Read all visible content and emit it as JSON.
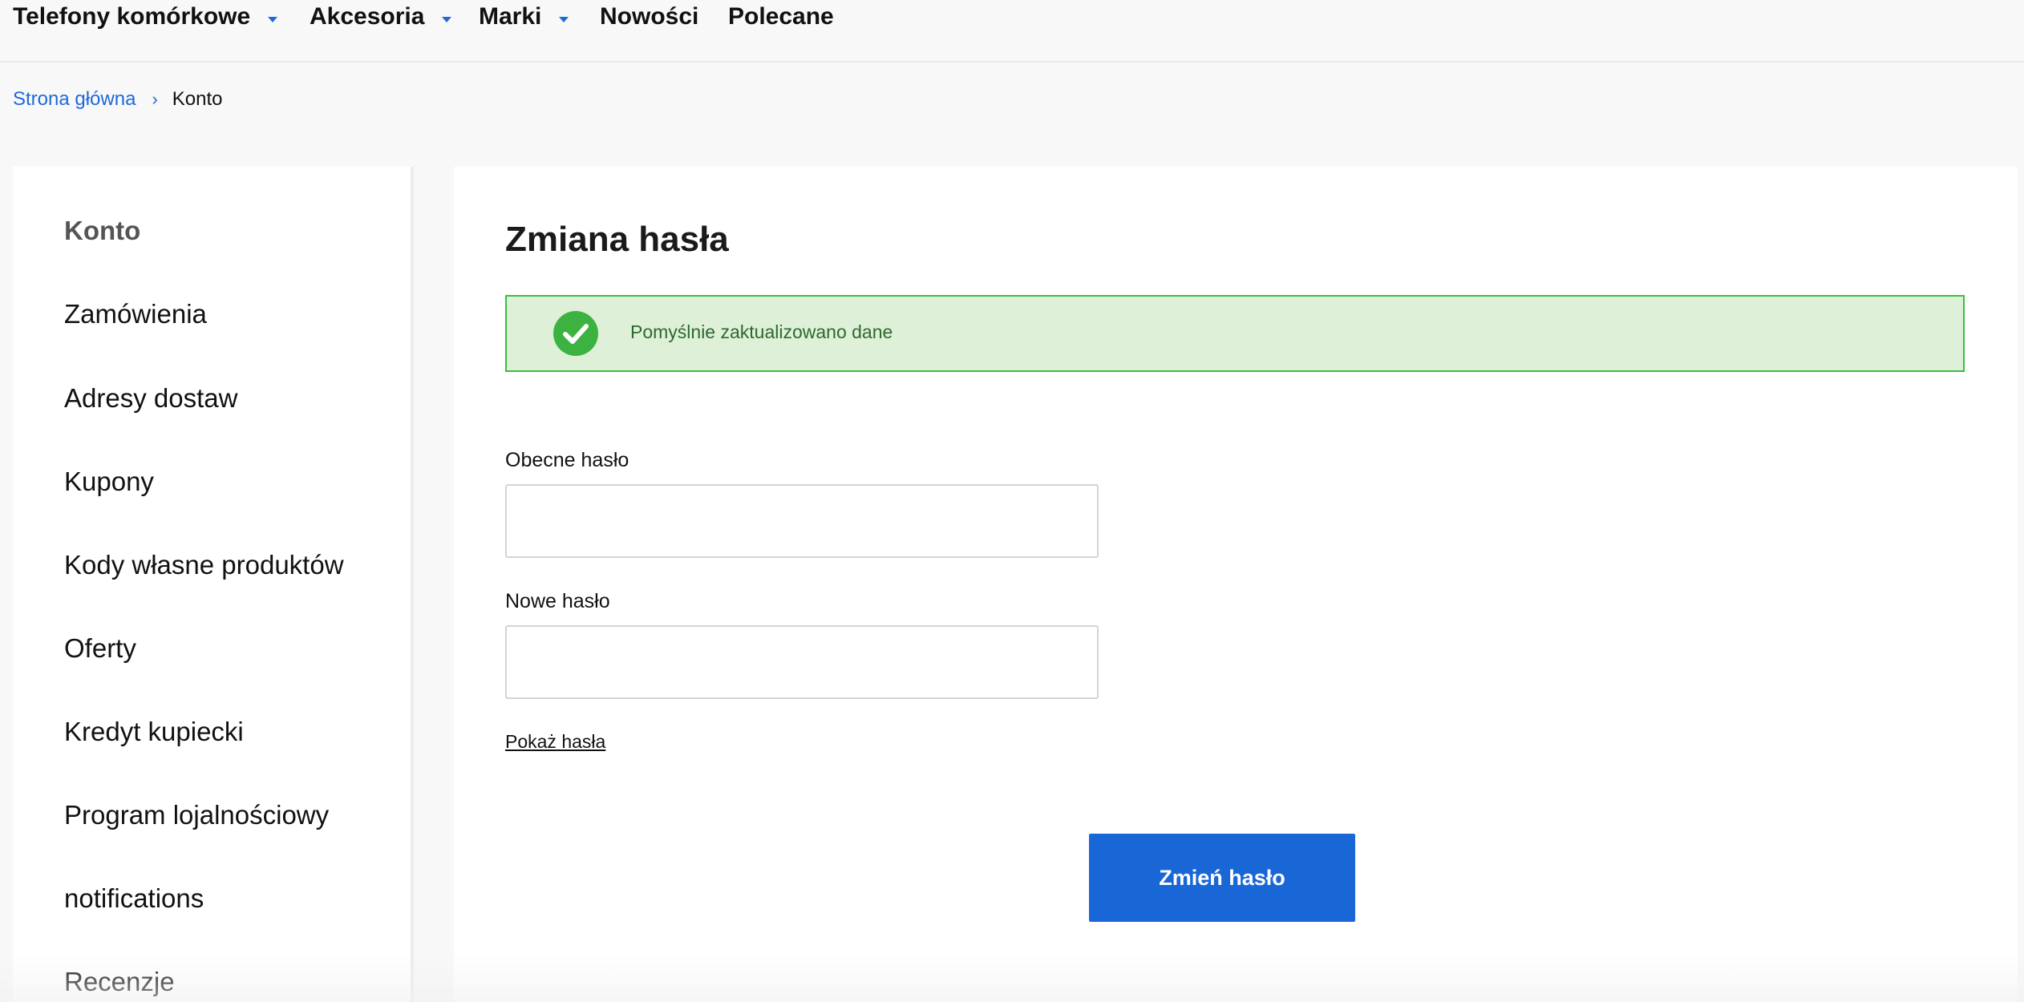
{
  "nav": {
    "items": [
      {
        "label": "Telefony komórkowe",
        "has_dropdown": true
      },
      {
        "label": "Akcesoria",
        "has_dropdown": true
      },
      {
        "label": "Marki",
        "has_dropdown": true
      },
      {
        "label": "Nowości",
        "has_dropdown": false
      },
      {
        "label": "Polecane",
        "has_dropdown": false
      }
    ]
  },
  "breadcrumb": {
    "home": "Strona główna",
    "separator": "›",
    "current": "Konto"
  },
  "sidebar": {
    "items": [
      {
        "label": "Konto",
        "active": true
      },
      {
        "label": "Zamówienia",
        "active": false
      },
      {
        "label": "Adresy dostaw",
        "active": false
      },
      {
        "label": "Kupony",
        "active": false
      },
      {
        "label": "Kody własne produktów",
        "active": false
      },
      {
        "label": "Oferty",
        "active": false
      },
      {
        "label": "Kredyt kupiecki",
        "active": false
      },
      {
        "label": "Program lojalnościowy",
        "active": false
      },
      {
        "label": "notifications",
        "active": false
      },
      {
        "label": "Recenzje",
        "active": false
      }
    ]
  },
  "main": {
    "title": "Zmiana hasła",
    "alert": {
      "message": "Pomyślnie zaktualizowano dane",
      "icon": "check-circle-icon"
    },
    "fields": {
      "current_password": {
        "label": "Obecne hasło",
        "value": "",
        "placeholder": ""
      },
      "new_password": {
        "label": "Nowe hasło",
        "value": "",
        "placeholder": ""
      }
    },
    "show_password_label": "Pokaż hasła",
    "submit_label": "Zmień hasło"
  },
  "colors": {
    "accent": "#1967d6",
    "success_bg": "#dff0d8",
    "success_border": "#38c13a",
    "success_icon": "#3cb340",
    "success_text": "#2c6a2e"
  }
}
